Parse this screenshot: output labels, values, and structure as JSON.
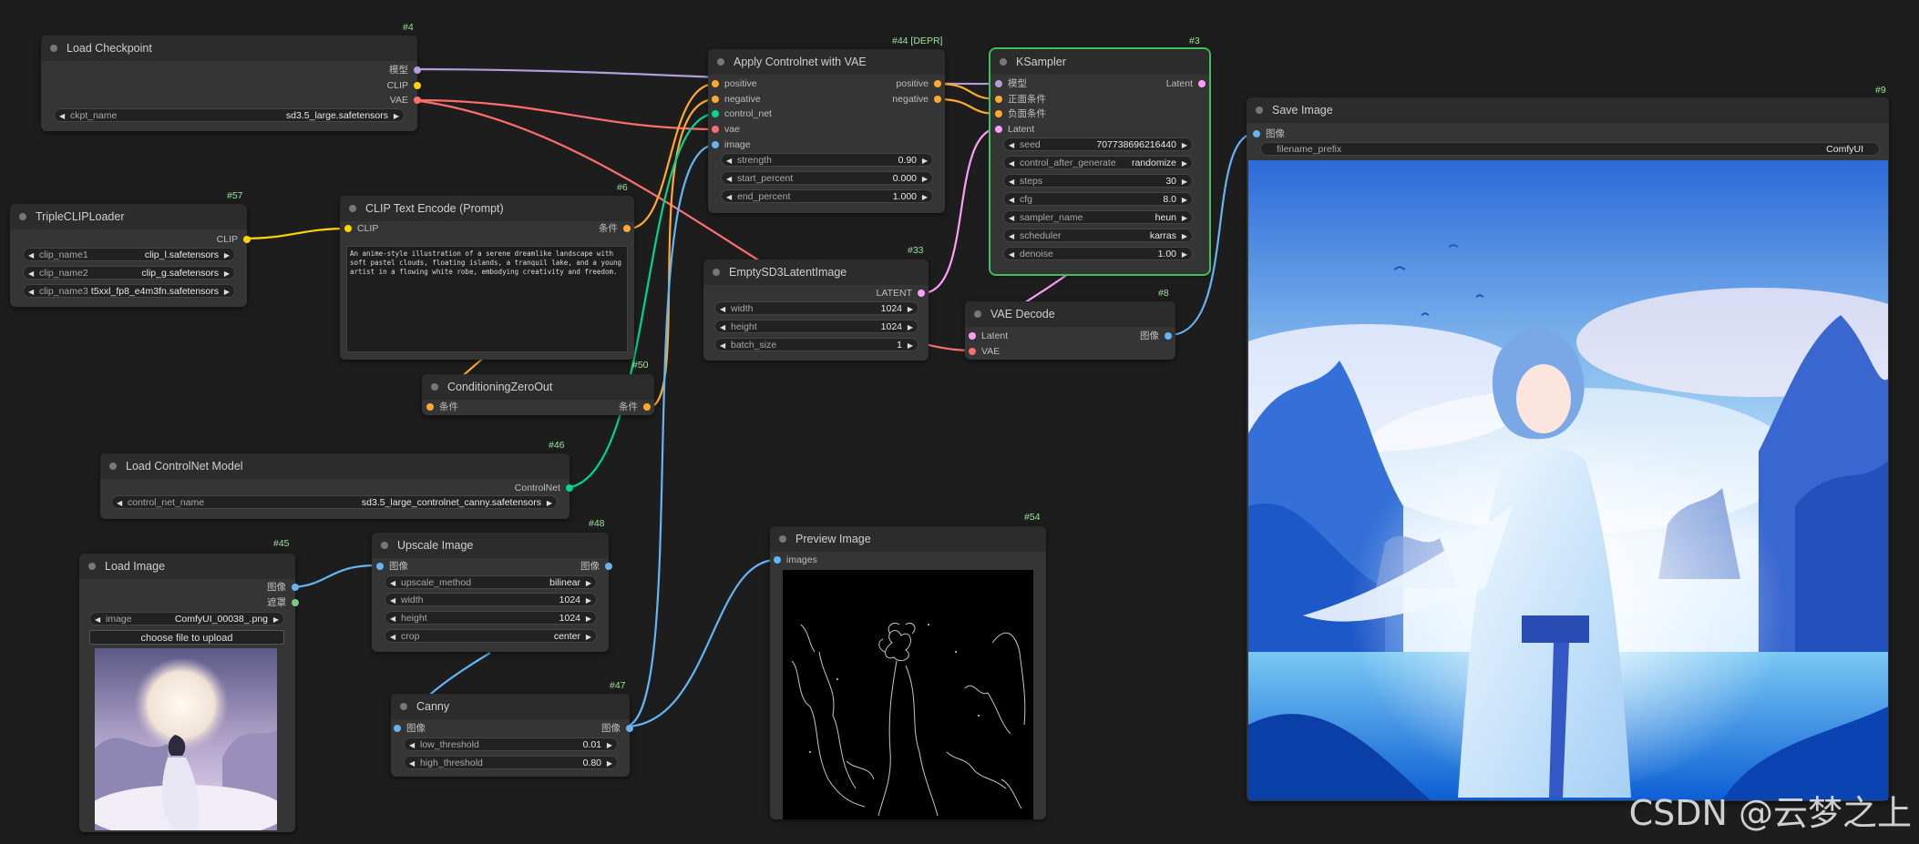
{
  "colors": {
    "model": "#b39ddb",
    "clip": "#ffd500",
    "vae": "#ff6e6e",
    "conditioning": "#ffa931",
    "latent": "#ff9cf9",
    "image": "#64b5f6",
    "control_net": "#00d78d",
    "selected_outline": "#3fbf5f"
  },
  "nodes": {
    "load_checkpoint": {
      "id": "#4",
      "title": "Load Checkpoint",
      "out_model": "模型",
      "out_clip": "CLIP",
      "out_vae": "VAE",
      "ckpt_label": "ckpt_name",
      "ckpt_value": "sd3.5_large.safetensors"
    },
    "triple_clip": {
      "id": "#57",
      "title": "TripleCLIPLoader",
      "out_clip": "CLIP",
      "w1_label": "clip_name1",
      "w1_value": "clip_l.safetensors",
      "w2_label": "clip_name2",
      "w2_value": "clip_g.safetensors",
      "w3_label": "clip_name3",
      "w3_value": "t5xxl_fp8_e4m3fn.safetensors"
    },
    "clip_text": {
      "id": "#6",
      "title": "CLIP Text Encode (Prompt)",
      "in_clip": "CLIP",
      "out_cond": "条件",
      "prompt": "An anime-style illustration of a serene dreamlike landscape with soft pastel clouds, floating islands, a tranquil lake, and a young artist in a flowing white robe, embodying creativity and freedom."
    },
    "cond_zero": {
      "id": "#50",
      "title": "ConditioningZeroOut",
      "in_cond": "条件",
      "out_cond": "条件"
    },
    "load_controlnet": {
      "id": "#46",
      "title": "Load ControlNet Model",
      "out_cn": "ControlNet",
      "w_label": "control_net_name",
      "w_value": "sd3.5_large_controlnet_canny.safetensors"
    },
    "load_image": {
      "id": "#45",
      "title": "Load Image",
      "out_image": "图像",
      "out_mask": "遮罩",
      "w_label": "image",
      "w_value": "ComfyUI_00038_.png",
      "upload_label": "choose file to upload"
    },
    "upscale": {
      "id": "#48",
      "title": "Upscale Image",
      "in_image": "图像",
      "out_image": "图像",
      "w1_label": "upscale_method",
      "w1_value": "bilinear",
      "w2_label": "width",
      "w2_value": "1024",
      "w3_label": "height",
      "w3_value": "1024",
      "w4_label": "crop",
      "w4_value": "center"
    },
    "canny": {
      "id": "#47",
      "title": "Canny",
      "in_image": "图像",
      "out_image": "图像",
      "w1_label": "low_threshold",
      "w1_value": "0.01",
      "w2_label": "high_threshold",
      "w2_value": "0.80"
    },
    "apply_cn": {
      "id": "#44 [DEPR]",
      "title": "Apply Controlnet with VAE",
      "in_positive": "positive",
      "in_negative": "negative",
      "in_cn": "control_net",
      "in_vae": "vae",
      "in_image": "image",
      "out_positive": "positive",
      "out_negative": "negative",
      "w1_label": "strength",
      "w1_value": "0.90",
      "w2_label": "start_percent",
      "w2_value": "0.000",
      "w3_label": "end_percent",
      "w3_value": "1.000"
    },
    "empty_latent": {
      "id": "#33",
      "title": "EmptySD3LatentImage",
      "out_latent": "LATENT",
      "w1_label": "width",
      "w1_value": "1024",
      "w2_label": "height",
      "w2_value": "1024",
      "w3_label": "batch_size",
      "w3_value": "1"
    },
    "preview": {
      "id": "#54",
      "title": "Preview Image",
      "in_images": "images"
    },
    "ksampler": {
      "id": "#3",
      "title": "KSampler",
      "in_model": "模型",
      "in_pos": "正面条件",
      "in_neg": "负面条件",
      "in_latent": "Latent",
      "out_latent": "Latent",
      "w1_label": "seed",
      "w1_value": "707738696216440",
      "w2_label": "control_after_generate",
      "w2_value": "randomize",
      "w3_label": "steps",
      "w3_value": "30",
      "w4_label": "cfg",
      "w4_value": "8.0",
      "w5_label": "sampler_name",
      "w5_value": "heun",
      "w6_label": "scheduler",
      "w6_value": "karras",
      "w7_label": "denoise",
      "w7_value": "1.00"
    },
    "vae_decode": {
      "id": "#8",
      "title": "VAE Decode",
      "in_latent": "Latent",
      "in_vae": "VAE",
      "out_image": "图像"
    },
    "save_image": {
      "id": "#9",
      "title": "Save Image",
      "in_image": "图像",
      "w_label": "filename_prefix",
      "w_value": "ComfyUI"
    }
  },
  "watermark": "CSDN @云梦之上"
}
